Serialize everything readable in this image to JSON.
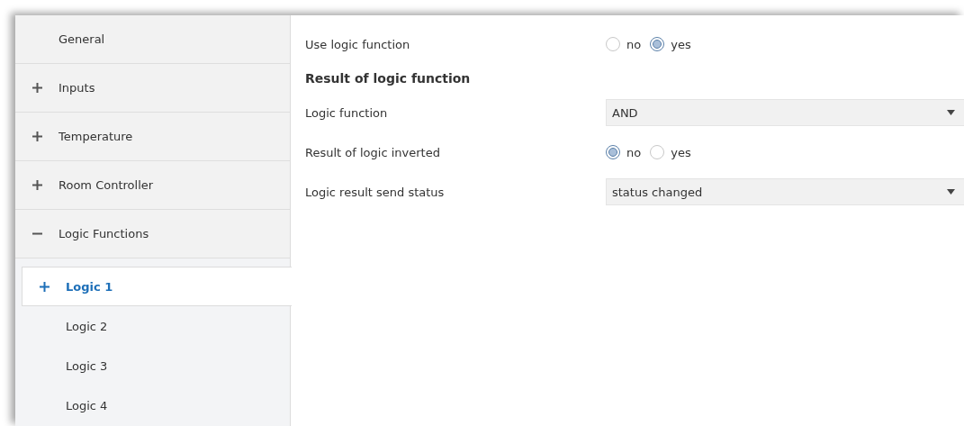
{
  "sidebar": {
    "items": [
      {
        "label": "General",
        "selected": false
      },
      {
        "label": "Inputs",
        "selected": false,
        "expanded": false
      },
      {
        "label": "Temperature",
        "selected": false,
        "expanded": false
      },
      {
        "label": "Room Controller",
        "selected": false,
        "expanded": false
      },
      {
        "label": "Logic Functions",
        "selected": false,
        "expanded": true,
        "children": [
          {
            "label": "Logic 1",
            "selected": true,
            "expanded": false
          },
          {
            "label": "Logic 2",
            "selected": false
          },
          {
            "label": "Logic 3",
            "selected": false
          },
          {
            "label": "Logic 4",
            "selected": false
          }
        ]
      }
    ]
  },
  "parameters": [
    {
      "kind": "radio",
      "label": "Use logic function",
      "options": [
        {
          "label": "no",
          "selected": false
        },
        {
          "label": "yes",
          "selected": true
        }
      ]
    },
    {
      "kind": "heading",
      "label": "Result of logic function"
    },
    {
      "kind": "dropdown",
      "label": "Logic function",
      "value": "AND"
    },
    {
      "kind": "radio",
      "label": "Result of logic inverted",
      "options": [
        {
          "label": "no",
          "selected": true
        },
        {
          "label": "yes",
          "selected": false
        }
      ]
    },
    {
      "kind": "dropdown",
      "label": "Logic result send status",
      "value": "status changed"
    }
  ]
}
